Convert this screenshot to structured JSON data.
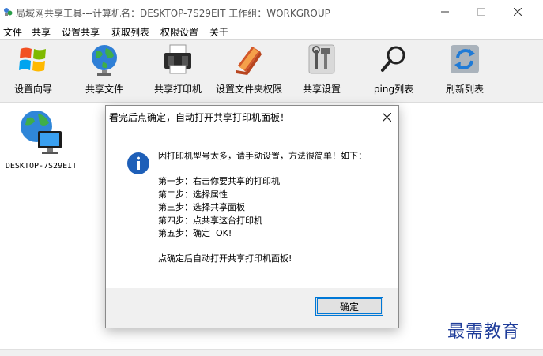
{
  "window": {
    "title": "局域网共享工具---计算机名：DESKTOP-7S29EIT   工作组：WORKGROUP",
    "minimize_glyph": "—",
    "maximize_glyph": "☐",
    "close_glyph": "✕"
  },
  "menu": {
    "items": [
      {
        "label": "文件"
      },
      {
        "label": "共享"
      },
      {
        "label": "设置共享"
      },
      {
        "label": "获取列表"
      },
      {
        "label": "权限设置"
      },
      {
        "label": "关于"
      }
    ]
  },
  "toolbar": {
    "items": [
      {
        "label": "设置向导",
        "icon": "windows-logo-icon"
      },
      {
        "label": "共享文件",
        "icon": "globe-icon"
      },
      {
        "label": "共享打印机",
        "icon": "printer-icon"
      },
      {
        "label": "设置文件夹权限",
        "icon": "folder-icon"
      },
      {
        "label": "共享设置",
        "icon": "tools-icon"
      },
      {
        "label": "ping列表",
        "icon": "magnifier-icon"
      },
      {
        "label": "刷新列表",
        "icon": "refresh-icon"
      }
    ]
  },
  "computers": [
    {
      "name": "DESKTOP-7S29EIT"
    }
  ],
  "dialog": {
    "title": "看完后点确定，自动打开共享打印机面板！",
    "close_glyph": "✕",
    "intro": "因打印机型号太多，请手动设置，方法很简单！如下：",
    "steps": [
      "第一步：右击你要共享的打印机",
      "第二步：选择属性",
      "第三步：选择共享面板",
      "第四步：点共享这台打印机",
      "第五步：确定  OK!"
    ],
    "footer_note": "点确定后自动打开共享打印机面板!",
    "ok_label": "确定"
  },
  "watermark": "最需教育",
  "colors": {
    "accent": "#0078d7",
    "watermark": "#1f3d9a",
    "info_icon": "#1e5fb8"
  }
}
